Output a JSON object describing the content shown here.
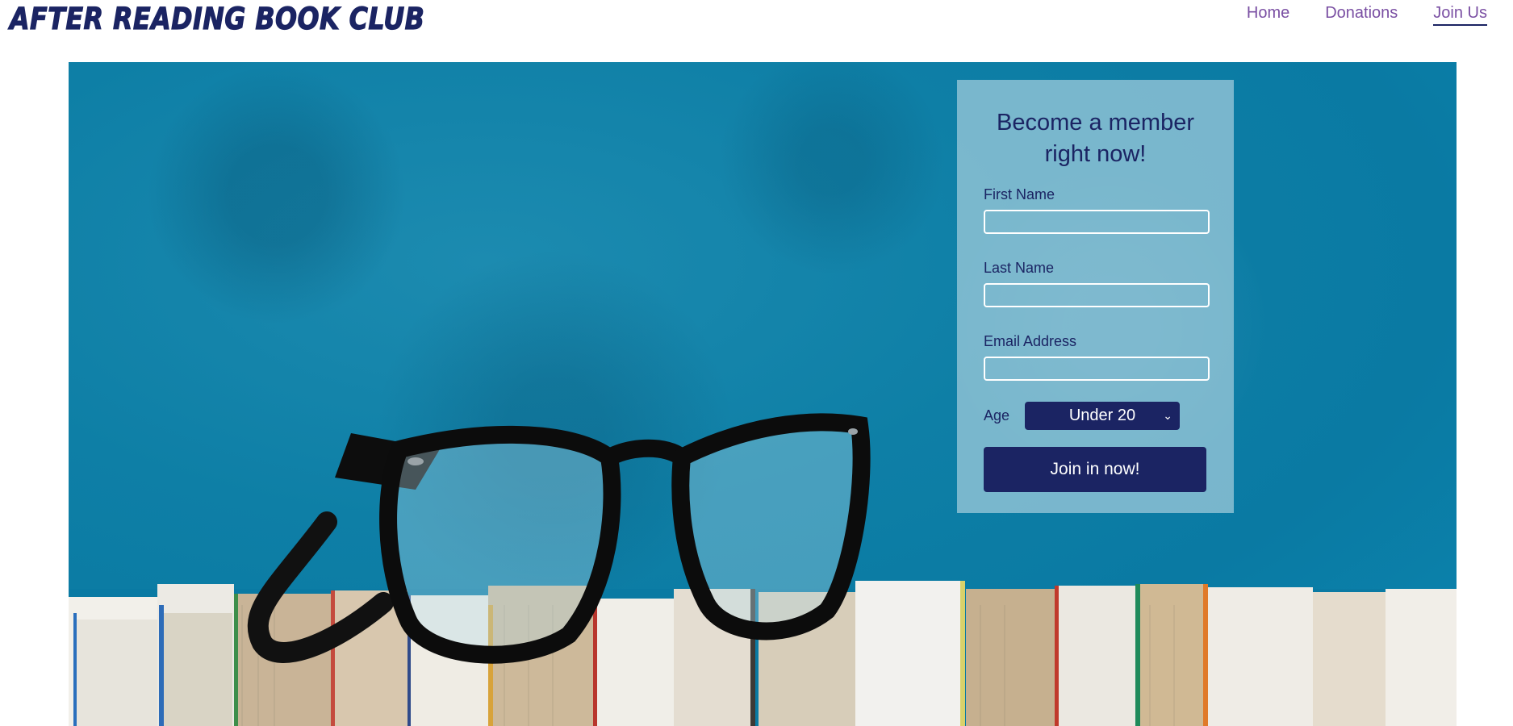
{
  "header": {
    "logo_text": "AFTER READING BOOK CLUB",
    "nav": [
      {
        "label": "Home"
      },
      {
        "label": "Donations"
      },
      {
        "label": "Join Us",
        "active": true
      }
    ]
  },
  "form": {
    "title": "Become a member right now!",
    "first_name_label": "First Name",
    "first_name_value": "",
    "last_name_label": "Last Name",
    "last_name_value": "",
    "email_label": "Email Address",
    "email_value": "",
    "age_label": "Age",
    "age_selected": "Under 20",
    "submit_label": "Join in now!"
  },
  "colors": {
    "brand_navy": "#1b2463",
    "nav_link": "#7a4fa3",
    "hero_blue": "#0a7aa3"
  },
  "icons": {
    "select_chevron": "chevron-down-icon"
  }
}
